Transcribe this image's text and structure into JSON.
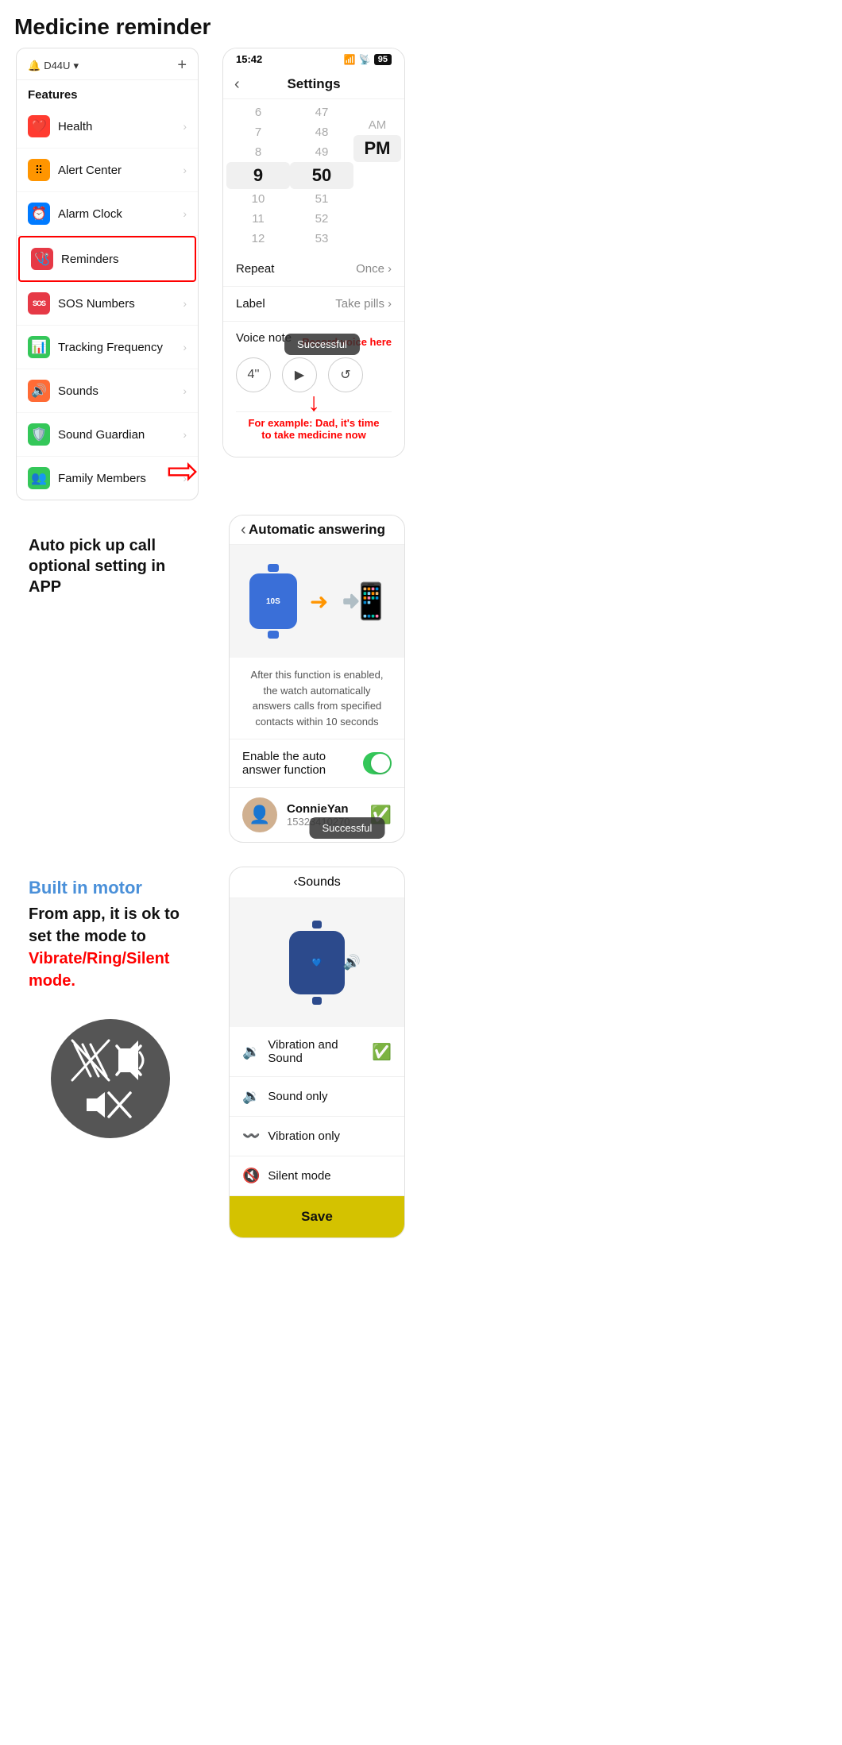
{
  "page": {
    "title": "Medicine reminder"
  },
  "sidebar": {
    "device": "D44U",
    "features_label": "Features",
    "items": [
      {
        "id": "health",
        "label": "Health",
        "icon": "❤️",
        "icon_class": "red"
      },
      {
        "id": "alert-center",
        "label": "Alert Center",
        "icon": "🟧",
        "icon_class": "orange"
      },
      {
        "id": "alarm-clock",
        "label": "Alarm Clock",
        "icon": "🕐",
        "icon_class": "blue"
      },
      {
        "id": "reminders",
        "label": "Reminders",
        "icon": "🩺",
        "icon_class": "red-box",
        "highlighted": true
      },
      {
        "id": "sos-numbers",
        "label": "SOS Numbers",
        "icon": "SOS",
        "icon_class": "sos"
      },
      {
        "id": "tracking-frequency",
        "label": "Tracking Frequency",
        "icon": "📊",
        "icon_class": "green-track"
      },
      {
        "id": "sounds",
        "label": "Sounds",
        "icon": "🔉",
        "icon_class": "sounds-icon"
      },
      {
        "id": "sound-guardian",
        "label": "Sound Guardian",
        "icon": "🛡️",
        "icon_class": "sound-guardian"
      },
      {
        "id": "family-members",
        "label": "Family Members",
        "icon": "👥",
        "icon_class": "family"
      }
    ]
  },
  "settings_screen": {
    "title": "Settings",
    "time": {
      "rows": [
        {
          "hour": "6",
          "minute": "47",
          "ampm": ""
        },
        {
          "hour": "7",
          "minute": "48",
          "ampm": ""
        },
        {
          "hour": "8",
          "minute": "49",
          "ampm": "AM"
        },
        {
          "hour": "9",
          "minute": "50",
          "ampm": "PM",
          "selected": true
        },
        {
          "hour": "10",
          "minute": "51",
          "ampm": ""
        },
        {
          "hour": "11",
          "minute": "52",
          "ampm": ""
        },
        {
          "hour": "12",
          "minute": "53",
          "ampm": ""
        }
      ]
    },
    "repeat_label": "Repeat",
    "repeat_value": "Once",
    "label_label": "Label",
    "label_value": "Take pills",
    "voice_note_label": "Voice note",
    "voice_duration": "4''",
    "success_toast": "Successful",
    "record_annotation": "Record voice here",
    "example_annotation": "For example: Dad, it's time to take medicine now"
  },
  "auto_answer_screen": {
    "back_title": "Automatic answering",
    "description": "After this function is enabled, the watch automatically answers calls from specified contacts within 10 seconds",
    "toggle_label": "Enable the auto answer function",
    "contact": {
      "name": "ConnieYan",
      "phone": "15323410270"
    },
    "success_toast": "Successful"
  },
  "auto_pickup": {
    "title": "Auto pick up call optional setting in APP"
  },
  "motor_section": {
    "title": "Built in motor",
    "desc1": "From app, it is ok to set the mode to",
    "modes": "Vibrate/Ring/Silent mode."
  },
  "sounds_screen": {
    "title": "Sounds",
    "options": [
      {
        "id": "vibration-sound",
        "label": "Vibration and Sound",
        "icon": "🔉",
        "selected": true
      },
      {
        "id": "sound-only",
        "label": "Sound only",
        "icon": "🔉"
      },
      {
        "id": "vibration-only",
        "label": "Vibration only",
        "icon": "〰️"
      },
      {
        "id": "silent-mode",
        "label": "Silent mode",
        "icon": "🔇"
      }
    ],
    "save_button": "Save"
  },
  "status_bar": {
    "time": "15:42",
    "battery": "95"
  }
}
